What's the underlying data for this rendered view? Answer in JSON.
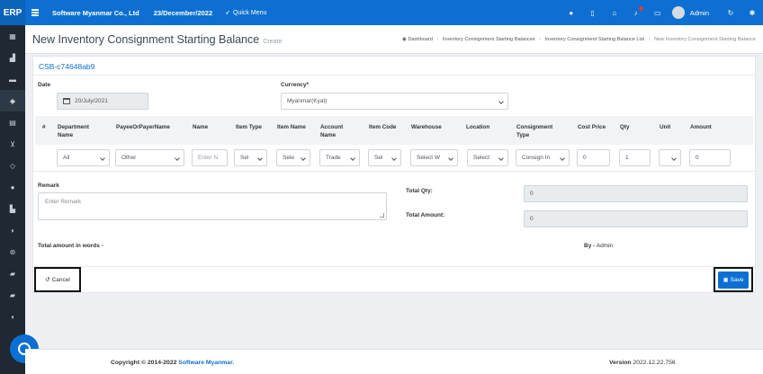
{
  "topbar": {
    "brand": "ERP",
    "company": "Software Myanmar Co., Ltd",
    "date": "23/December/2022",
    "quick_menu": "Quick Menu",
    "icons": [
      "chat-icon",
      "document-icon",
      "home-icon",
      "bell-icon",
      "clipboard-icon",
      "refresh-icon",
      "gear-icon"
    ],
    "user": "Admin"
  },
  "sidebar": {
    "icons": [
      "calculator-icon",
      "chart-icon",
      "card-icon",
      "box-icon",
      "clipboard-icon",
      "cart-icon",
      "diamond-icon",
      "users-icon",
      "factory-icon",
      "leaf-icon",
      "cog-icon",
      "book-icon",
      "book-icon",
      "comment-icon"
    ],
    "active_index": 3
  },
  "header": {
    "title": "New Inventory Consignment Starting Balance",
    "subtitle": "Create",
    "breadcrumb": [
      "Dashboard",
      "Inventory Consignment Starting Balances",
      "Inventory Consignment Starting Balance List",
      "New Inventory Consignment Starting Balance"
    ]
  },
  "form": {
    "code": "CSB-c74648ab9",
    "date_label": "Date",
    "date_value": "20/July/2021",
    "currency_label": "Currency*",
    "currency_value": "Myanmar(Kyat)",
    "columns": [
      {
        "label": "#"
      },
      {
        "label": "Department Name"
      },
      {
        "label": "PayeeOrPayerName"
      },
      {
        "label": "Name"
      },
      {
        "label": "Item Type"
      },
      {
        "label": "Item Name"
      },
      {
        "label": "Account Name"
      },
      {
        "label": "Item Code"
      },
      {
        "label": "Warehouse"
      },
      {
        "label": "Location"
      },
      {
        "label": "Consignment Type"
      },
      {
        "label": "Cost Price"
      },
      {
        "label": "Qty"
      },
      {
        "label": "Unit"
      },
      {
        "label": "Amount"
      }
    ],
    "row": {
      "department": "All",
      "payee": "Other",
      "name_placeholder": "Enter N",
      "item_type": "Sel",
      "item_name": "Sele",
      "account_name": "Trade",
      "item_code": "Sel",
      "warehouse": "Select W",
      "location": "Select",
      "consignment_type": "Consign In",
      "cost_price": "0",
      "qty": "1",
      "unit": "",
      "amount": "0"
    },
    "remark_label": "Remark",
    "remark_placeholder": "Enter Remark",
    "total_qty_label": "Total Qty:",
    "total_qty_value": "0",
    "total_amount_label": "Total Amount:",
    "total_amount_value": "0",
    "words_label": "Total amount in words -",
    "by_label": "By -",
    "by_value": "Admin",
    "cancel_label": "Cancel",
    "save_label": "Save"
  },
  "footer": {
    "copyright": "Copyright © 2014-2022",
    "company_link": "Software Myanmar.",
    "version_label": "Version",
    "version_value": "2022.12.22.756"
  },
  "colors": {
    "primary": "#0d6fd1",
    "sidebar": "#1f2833",
    "button_border": "#111111"
  }
}
